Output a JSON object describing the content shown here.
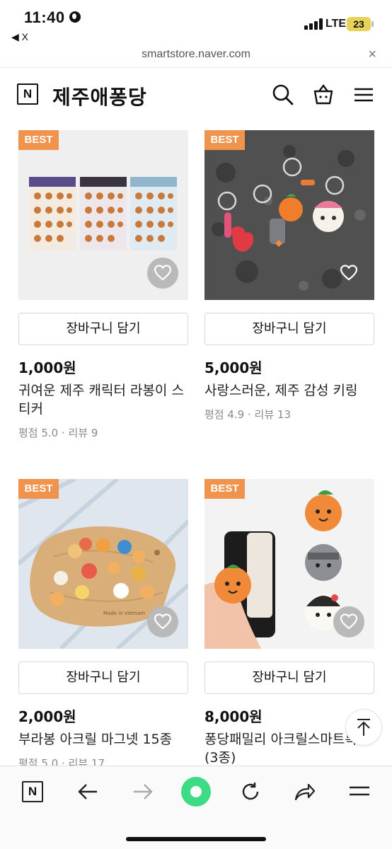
{
  "status_bar": {
    "time": "11:40",
    "back_label": "◀ X",
    "network": "LTE",
    "battery": "23"
  },
  "url_bar": {
    "url": "smartstore.naver.com",
    "close": "×"
  },
  "header": {
    "logo_letter": "N",
    "store_name": "제주애퐁당"
  },
  "products": [
    {
      "badge": "BEST",
      "cart_label": "장바구니 담기",
      "price": "1,000원",
      "name": "귀여운 제주 캐릭터 라봉이 스티커",
      "meta": "평점 5.0 · 리뷰 9",
      "photo_text": ""
    },
    {
      "badge": "BEST",
      "cart_label": "장바구니 담기",
      "price": "5,000원",
      "name": "사랑스러운, 제주 감성 키링",
      "meta": "평점 4.9 · 리뷰 13",
      "photo_text": ""
    },
    {
      "badge": "BEST",
      "cart_label": "장바구니 담기",
      "price": "2,000원",
      "name": "부라봉 아크릴 마그넷 15종",
      "meta": "평점 5.0 · 리뷰 17",
      "photo_text": "Made in Vietnam"
    },
    {
      "badge": "BEST",
      "cart_label": "장바구니 담기",
      "price": "8,000원",
      "name": "퐁당패밀리 아크릴스마트톡 (3종)",
      "meta": "",
      "photo_text": ""
    }
  ],
  "colors": {
    "best_badge": "#f0944d",
    "accent_green": "#3ddc84"
  },
  "icons": {
    "header": [
      "search-icon",
      "shopping-bag-icon",
      "menu-icon"
    ],
    "toolbar": [
      "naver-home-icon",
      "back-arrow-icon",
      "forward-arrow-icon",
      "green-dot-icon",
      "refresh-icon",
      "share-icon",
      "menu-icon"
    ],
    "wishlist": "heart-outline-icon",
    "scroll_top": "arrow-up-icon"
  }
}
